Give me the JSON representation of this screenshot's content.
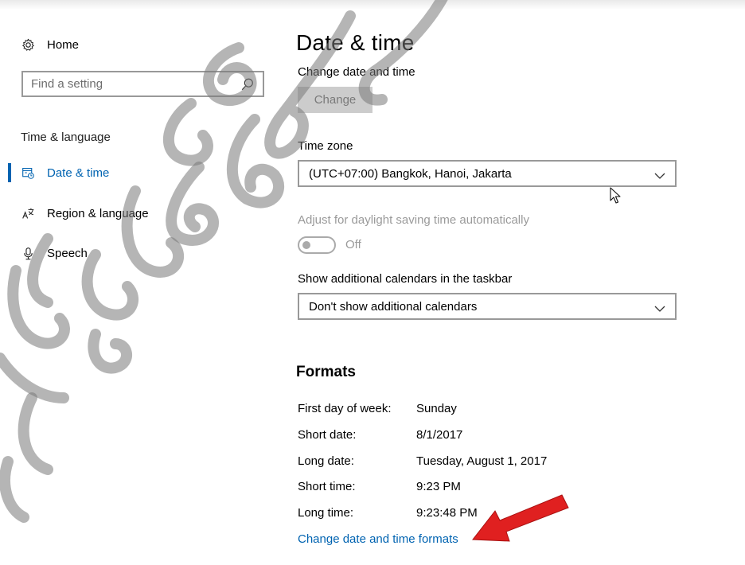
{
  "sidebar": {
    "home_label": "Home",
    "home_icon": "gear-icon",
    "search_placeholder": "Find a setting",
    "search_icon": "search-icon",
    "section_label": "Time & language",
    "items": [
      {
        "label": "Date & time",
        "icon": "calendar-clock-icon",
        "active": true
      },
      {
        "label": "Region & language",
        "icon": "language-icon",
        "active": false
      },
      {
        "label": "Speech",
        "icon": "microphone-icon",
        "active": false
      }
    ]
  },
  "main": {
    "title": "Date & time",
    "change_label": "Change date and time",
    "change_button": "Change",
    "timezone_label": "Time zone",
    "timezone_value": "(UTC+07:00) Bangkok, Hanoi, Jakarta",
    "dst_label": "Adjust for daylight saving time automatically",
    "dst_toggle_state": "Off",
    "calendars_label": "Show additional calendars in the taskbar",
    "calendars_value": "Don't show additional calendars",
    "formats_title": "Formats",
    "formats": [
      {
        "key": "First day of week:",
        "value": "Sunday"
      },
      {
        "key": "Short date:",
        "value": "8/1/2017"
      },
      {
        "key": "Long date:",
        "value": "Tuesday, August 1, 2017"
      },
      {
        "key": "Short time:",
        "value": "9:23 PM"
      },
      {
        "key": "Long time:",
        "value": "9:23:48 PM"
      }
    ],
    "formats_link": "Change date and time formats"
  },
  "colors": {
    "accent": "#0063b1",
    "annotation_arrow": "#e02020",
    "disabled_text": "#9a9a9a"
  }
}
